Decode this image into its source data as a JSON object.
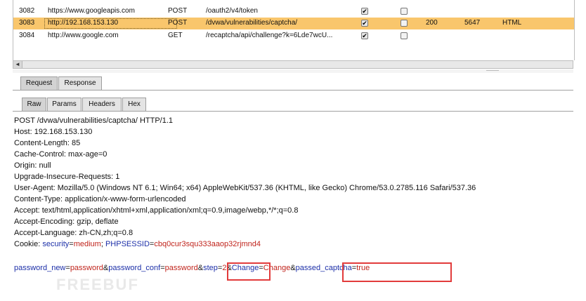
{
  "history": {
    "rows": [
      {
        "num": "3082",
        "host": "https://www.googleapis.com",
        "method": "POST",
        "url": "/oauth2/v4/token",
        "params": true,
        "edited": false,
        "status": "",
        "length": "",
        "mime": "",
        "selected": false
      },
      {
        "num": "3083",
        "host": "http://192.168.153.130",
        "method": "POST",
        "url": "/dvwa/vulnerabilities/captcha/",
        "params": true,
        "edited": false,
        "status": "200",
        "length": "5647",
        "mime": "HTML",
        "selected": true
      },
      {
        "num": "3084",
        "host": "http://www.google.com",
        "method": "GET",
        "url": "/recaptcha/api/challenge?k=6Lde7wcU...",
        "params": true,
        "edited": false,
        "status": "",
        "length": "",
        "mime": "",
        "selected": false
      }
    ]
  },
  "tabs": {
    "primary": [
      "Request",
      "Response"
    ],
    "secondary": [
      "Raw",
      "Params",
      "Headers",
      "Hex"
    ]
  },
  "request": {
    "lines": [
      "POST /dvwa/vulnerabilities/captcha/ HTTP/1.1",
      "Host: 192.168.153.130",
      "Content-Length: 85",
      "Cache-Control: max-age=0",
      "Origin: null",
      "Upgrade-Insecure-Requests: 1",
      "User-Agent: Mozilla/5.0 (Windows NT 6.1; Win64; x64) AppleWebKit/537.36 (KHTML, like Gecko) Chrome/53.0.2785.116 Safari/537.36",
      "Content-Type: application/x-www-form-urlencoded",
      "Accept: text/html,application/xhtml+xml,application/xml;q=0.9,image/webp,*/*;q=0.8",
      "Accept-Encoding: gzip, deflate",
      "Accept-Language: zh-CN,zh;q=0.8"
    ],
    "cookie": {
      "label": "Cookie: ",
      "k1": "security",
      "v1": "medium",
      "sep": "; ",
      "k2": "PHPSESSID",
      "v2": "cbq0cur3squ333aaop32rjmnd4"
    },
    "body": {
      "k1": "password_new",
      "v1": "password",
      "k2": "password_conf",
      "v2": "password",
      "k3": "step",
      "v3": "2",
      "k4": "Change",
      "v4": "Change",
      "k5": "passed_captcha",
      "v5": "true"
    }
  },
  "watermark": "FREEBUF",
  "colors": {
    "selected_row": "#f9c66c",
    "highlight_box": "#e23b3b",
    "param_name": "#1c2fa8",
    "param_value": "#c0241c"
  }
}
